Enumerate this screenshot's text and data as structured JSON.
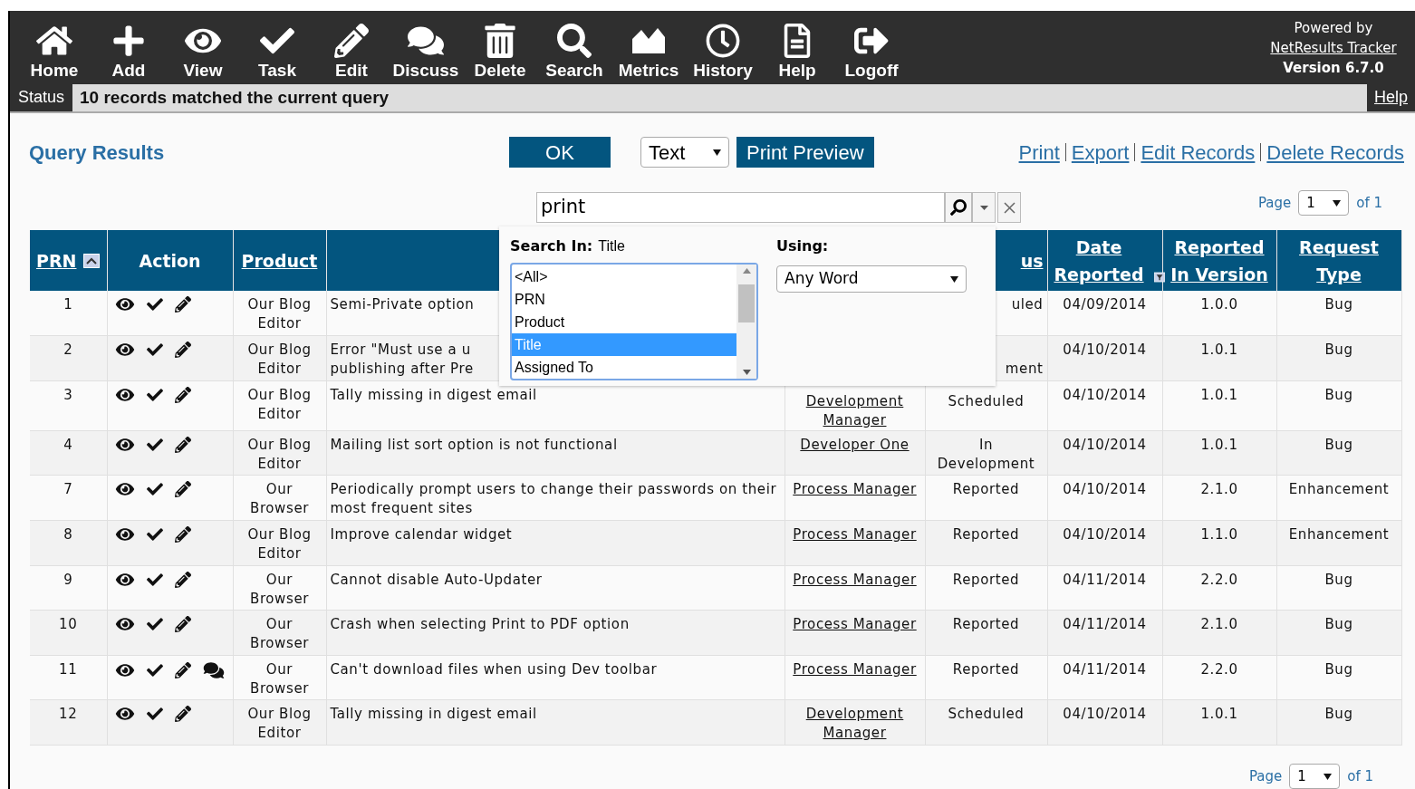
{
  "toolbar": {
    "items": [
      {
        "label": "Home"
      },
      {
        "label": "Add"
      },
      {
        "label": "View"
      },
      {
        "label": "Task"
      },
      {
        "label": "Edit"
      },
      {
        "label": "Discuss"
      },
      {
        "label": "Delete"
      },
      {
        "label": "Search"
      },
      {
        "label": "Metrics"
      },
      {
        "label": "History"
      },
      {
        "label": "Help"
      },
      {
        "label": "Logoff"
      }
    ],
    "powered_by": "Powered by",
    "product_link": "NetResults Tracker",
    "version": "Version 6.7.0"
  },
  "status_bar": {
    "label": "Status",
    "message": "10 records matched the current query",
    "help": "Help"
  },
  "title": "Query Results",
  "ok_button": "OK",
  "format_select": "Text",
  "print_preview_button": "Print Preview",
  "links": [
    "Print",
    "Export",
    "Edit Records",
    "Delete Records"
  ],
  "search": {
    "value": "print",
    "search_in_label": "Search In:",
    "search_in_value": "Title",
    "fields": [
      {
        "label": "<All>",
        "selected": false
      },
      {
        "label": "PRN",
        "selected": false
      },
      {
        "label": "Product",
        "selected": false
      },
      {
        "label": "Title",
        "selected": true
      },
      {
        "label": "Assigned To",
        "selected": false
      }
    ],
    "using_label": "Using:",
    "using_value": "Any Word"
  },
  "pager_top": {
    "label": "Page",
    "value": "1",
    "total": "of 1"
  },
  "table": {
    "columns": [
      {
        "label": "PRN",
        "link": true
      },
      {
        "label": "Action",
        "link": false
      },
      {
        "label": "Product",
        "link": true
      },
      {},
      {},
      {
        "label": "us",
        "link": true
      },
      {
        "label": "Date Reported",
        "link": true
      },
      {
        "label": "Reported In Version",
        "link": true
      },
      {
        "label": "Request Type",
        "link": true
      }
    ],
    "rows": [
      {
        "prn": "1",
        "discussion": false,
        "product": "Our Blog Editor",
        "title": "Semi-Private option",
        "status": "uled",
        "status_cut": true,
        "date": "04/09/2014",
        "version": "1.0.0",
        "type": "Bug"
      },
      {
        "prn": "2",
        "discussion": false,
        "product": "Our Blog Editor",
        "title": "Error \"Must use a u\npublishing after Pre",
        "status": "ment",
        "status_cut": true,
        "date": "04/10/2014",
        "version": "1.0.1",
        "type": "Bug"
      },
      {
        "prn": "3",
        "discussion": false,
        "product": "Our Blog Editor",
        "title": "Tally missing in digest email",
        "assigned": "Development Manager",
        "status": "Scheduled",
        "status_cut": false,
        "date": "04/10/2014",
        "version": "1.0.1",
        "type": "Bug"
      },
      {
        "prn": "4",
        "discussion": false,
        "product": "Our Blog Editor",
        "title": "Mailing list sort option is not functional",
        "assigned": "Developer One",
        "status": "In Development",
        "status_cut": false,
        "date": "04/10/2014",
        "version": "1.0.1",
        "type": "Bug"
      },
      {
        "prn": "7",
        "discussion": false,
        "product": "Our Browser",
        "title": "Periodically prompt users to change their passwords on their most frequent sites",
        "assigned": "Process Manager",
        "status": "Reported",
        "status_cut": false,
        "date": "04/10/2014",
        "version": "2.1.0",
        "type": "Enhancement"
      },
      {
        "prn": "8",
        "discussion": false,
        "product": "Our Blog Editor",
        "title": "Improve calendar widget",
        "assigned": "Process Manager",
        "status": "Reported",
        "status_cut": false,
        "date": "04/10/2014",
        "version": "1.1.0",
        "type": "Enhancement"
      },
      {
        "prn": "9",
        "discussion": false,
        "product": "Our Browser",
        "title": "Cannot disable Auto-Updater",
        "assigned": "Process Manager",
        "status": "Reported",
        "status_cut": false,
        "date": "04/11/2014",
        "version": "2.2.0",
        "type": "Bug"
      },
      {
        "prn": "10",
        "discussion": false,
        "product": "Our Browser",
        "title": "Crash when selecting Print to PDF option",
        "assigned": "Process Manager",
        "status": "Reported",
        "status_cut": false,
        "date": "04/11/2014",
        "version": "2.1.0",
        "type": "Bug"
      },
      {
        "prn": "11",
        "discussion": true,
        "product": "Our Browser",
        "title": "Can't download files when using Dev toolbar",
        "assigned": "Process Manager",
        "status": "Reported",
        "status_cut": false,
        "date": "04/11/2014",
        "version": "2.2.0",
        "type": "Bug"
      },
      {
        "prn": "12",
        "discussion": false,
        "product": "Our Blog Editor",
        "title": "Tally missing in digest email",
        "assigned": "Development Manager",
        "status": "Scheduled",
        "status_cut": false,
        "date": "04/10/2014",
        "version": "1.0.1",
        "type": "Bug"
      }
    ]
  },
  "pager_bottom": {
    "label": "Page",
    "value": "1",
    "total": "of 1"
  }
}
